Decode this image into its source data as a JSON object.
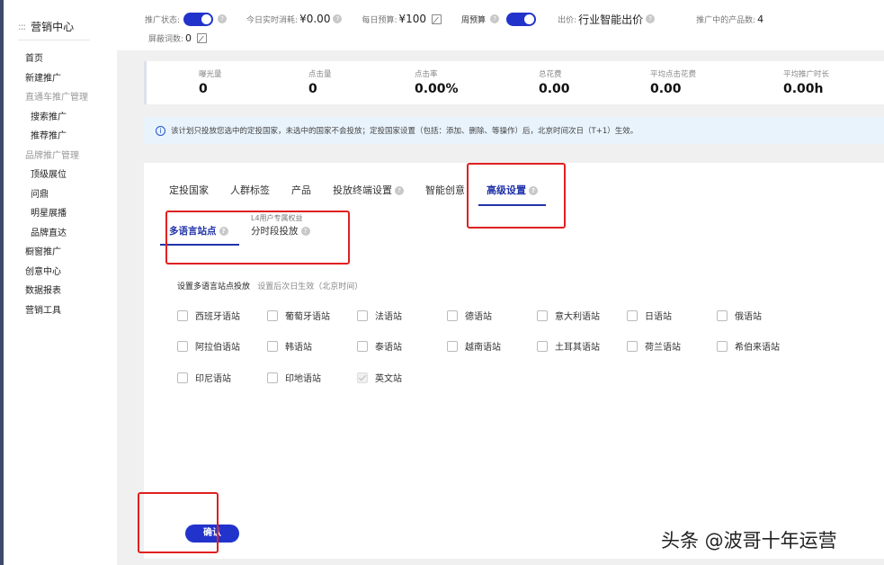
{
  "sidebar": {
    "title": "营销中心",
    "icon": "grid-icon",
    "items": [
      {
        "label": "首页",
        "kind": "item"
      },
      {
        "label": "新建推广",
        "kind": "item"
      },
      {
        "label": "直通车推广管理",
        "kind": "group"
      },
      {
        "label": "搜索推广",
        "kind": "sub"
      },
      {
        "label": "推荐推广",
        "kind": "sub"
      },
      {
        "label": "品牌推广管理",
        "kind": "group"
      },
      {
        "label": "顶级展位",
        "kind": "sub"
      },
      {
        "label": "问鼎",
        "kind": "sub"
      },
      {
        "label": "明星展播",
        "kind": "sub"
      },
      {
        "label": "品牌直达",
        "kind": "sub"
      },
      {
        "label": "橱窗推广",
        "kind": "item"
      },
      {
        "label": "创意中心",
        "kind": "item"
      },
      {
        "label": "数据报表",
        "kind": "item"
      },
      {
        "label": "营销工具",
        "kind": "item"
      }
    ]
  },
  "topbar": {
    "status_label": "推广状态:",
    "spend_label": "今日实时消耗:",
    "spend_value": "¥0.00",
    "daily_budget_label": "每日预算:",
    "daily_budget_value": "¥100",
    "weekly_budget_label": "周预算",
    "bid_label": "出价:",
    "bid_value": "行业智能出价",
    "products_label": "推广中的产品数:",
    "products_value": "4",
    "blocked_label": "屏蔽词数:",
    "blocked_value": "0"
  },
  "stats": [
    {
      "label": "曝光量",
      "value": "0"
    },
    {
      "label": "点击量",
      "value": "0"
    },
    {
      "label": "点击率",
      "value": "0.00%"
    },
    {
      "label": "总花费",
      "value": "0.00"
    },
    {
      "label": "平均点击花费",
      "value": "0.00"
    },
    {
      "label": "平均推广时长",
      "value": "0.00h"
    }
  ],
  "notice": {
    "text": "该计划只投放您选中的定投国家，未选中的国家不会投放；定投国家设置（包括：添加、删除、等操作）后，北京时间次日（T+1）生效。"
  },
  "tabs": [
    {
      "label": "定投国家",
      "active": false,
      "help": false
    },
    {
      "label": "人群标签",
      "active": false,
      "help": false
    },
    {
      "label": "产品",
      "active": false,
      "help": false
    },
    {
      "label": "投放终端设置",
      "active": false,
      "help": true
    },
    {
      "label": "智能创意",
      "active": false,
      "help": false
    },
    {
      "label": "高级设置",
      "active": true,
      "help": true
    }
  ],
  "subtabs": {
    "multilang": "多语言站点",
    "timeslot_note": "L4用户专属权益",
    "timeslot": "分时段投放"
  },
  "section": {
    "title": "设置多语言站点投放",
    "note": "设置后次日生效（北京时间）"
  },
  "languages": [
    {
      "label": "西班牙语站",
      "checked": false
    },
    {
      "label": "葡萄牙语站",
      "checked": false
    },
    {
      "label": "法语站",
      "checked": false
    },
    {
      "label": "德语站",
      "checked": false
    },
    {
      "label": "意大利语站",
      "checked": false
    },
    {
      "label": "日语站",
      "checked": false
    },
    {
      "label": "俄语站",
      "checked": false
    },
    {
      "label": "阿拉伯语站",
      "checked": false
    },
    {
      "label": "韩语站",
      "checked": false
    },
    {
      "label": "泰语站",
      "checked": false
    },
    {
      "label": "越南语站",
      "checked": false
    },
    {
      "label": "土耳其语站",
      "checked": false
    },
    {
      "label": "荷兰语站",
      "checked": false
    },
    {
      "label": "希伯来语站",
      "checked": false
    },
    {
      "label": "印尼语站",
      "checked": false
    },
    {
      "label": "印地语站",
      "checked": false
    },
    {
      "label": "英文站",
      "checked": true
    }
  ],
  "confirm_label": "确认",
  "watermark": "头条 @波哥十年运营",
  "colors": {
    "accent": "#2233cc",
    "highlight": "#e02020",
    "notice_bg": "#e9f3fc"
  }
}
